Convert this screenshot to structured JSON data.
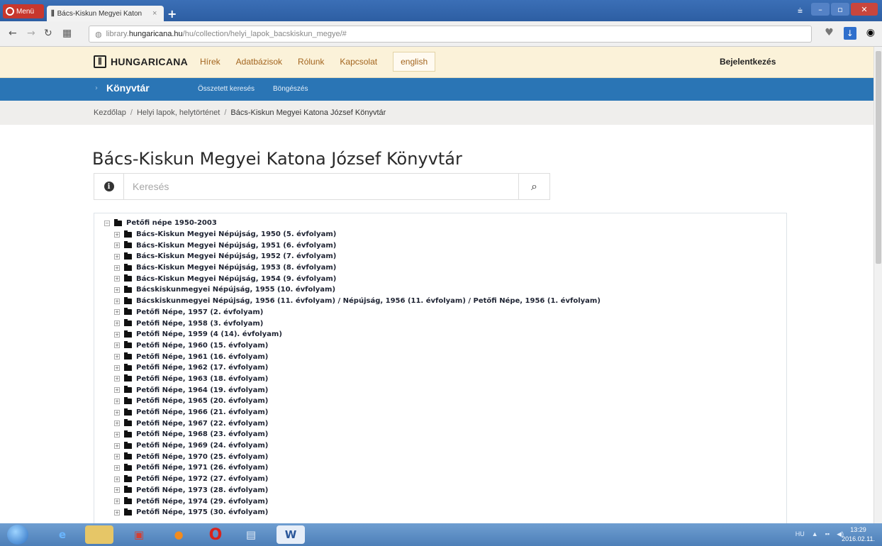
{
  "browser": {
    "menu_label": "Menü",
    "tab_title": "Bács-Kiskun Megyei Katon",
    "tab_close": "×",
    "new_tab": "+",
    "url_prefix": "library.",
    "url_host": "hungaricana.hu",
    "url_path": "/hu/collection/helyi_lapok_bacskiskun_megye/#"
  },
  "topnav": {
    "brand": "HUNGARICANA",
    "items": [
      "Hírek",
      "Adatbázisok",
      "Rólunk",
      "Kapcsolat"
    ],
    "lang": "english",
    "login": "Bejelentkezés"
  },
  "bluebar": {
    "section": "Könyvtár",
    "links": [
      "Összetett keresés",
      "Böngészés"
    ]
  },
  "breadcrumb": {
    "items": [
      "Kezdőlap",
      "Helyi lapok, helytörténet",
      "Bács-Kiskun Megyei Katona József Könyvtár"
    ],
    "separator": "/"
  },
  "page_title": "Bács-Kiskun Megyei Katona József Könyvtár",
  "search": {
    "placeholder": "Keresés"
  },
  "tree": {
    "root": "Petőfi népe 1950-2003",
    "children": [
      "Bács-Kiskun Megyei Népújság, 1950 (5. évfolyam)",
      "Bács-Kiskun Megyei Népújság, 1951 (6. évfolyam)",
      "Bács-Kiskun Megyei Népújság, 1952 (7. évfolyam)",
      "Bács-Kiskun Megyei Népújság, 1953 (8. évfolyam)",
      "Bács-Kiskun Megyei Népújság, 1954 (9. évfolyam)",
      "Bácskiskunmegyei Népújság, 1955 (10. évfolyam)",
      "Bácskiskunmegyei Népújság, 1956 (11. évfolyam) / Népújság, 1956 (11. évfolyam) / Petőfi Népe, 1956 (1. évfolyam)",
      "Petőfi Népe, 1957 (2. évfolyam)",
      "Petőfi Népe, 1958 (3. évfolyam)",
      "Petőfi Népe, 1959 (4 (14). évfolyam)",
      "Petőfi Népe, 1960 (15. évfolyam)",
      "Petőfi Népe, 1961 (16. évfolyam)",
      "Petőfi Népe, 1962 (17. évfolyam)",
      "Petőfi Népe, 1963 (18. évfolyam)",
      "Petőfi Népe, 1964 (19. évfolyam)",
      "Petőfi Népe, 1965 (20. évfolyam)",
      "Petőfi Népe, 1966 (21. évfolyam)",
      "Petőfi Népe, 1967 (22. évfolyam)",
      "Petőfi Népe, 1968 (23. évfolyam)",
      "Petőfi Népe, 1969 (24. évfolyam)",
      "Petőfi Népe, 1970 (25. évfolyam)",
      "Petőfi Népe, 1971 (26. évfolyam)",
      "Petőfi Népe, 1972 (27. évfolyam)",
      "Petőfi Népe, 1973 (28. évfolyam)",
      "Petőfi Népe, 1974 (29. évfolyam)",
      "Petőfi Népe, 1975 (30. évfolyam)"
    ]
  },
  "taskbar": {
    "lang": "HU",
    "time": "13:29",
    "date": "2016.02.11."
  },
  "colors": {
    "nav_bg": "#fbf2d9",
    "blue_bar": "#2a75b5",
    "menu_link": "#a3651f"
  }
}
